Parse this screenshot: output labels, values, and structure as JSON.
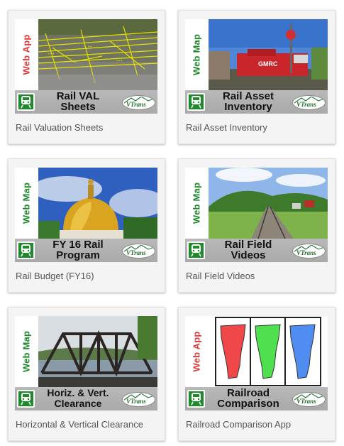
{
  "cards": [
    {
      "badge": "Web App",
      "badge_type": "app",
      "title_lines": [
        "Rail VAL",
        "Sheets"
      ],
      "caption": "Rail Valuation Sheets",
      "image": "aerial-railyard-photo"
    },
    {
      "badge": "Web Map",
      "badge_type": "map",
      "title_lines": [
        "Rail Asset",
        "Inventory"
      ],
      "caption": "Rail Asset Inventory",
      "image": "locomotive-photo"
    },
    {
      "badge": "Web Map",
      "badge_type": "map",
      "title_lines": [
        "FY 16 Rail",
        "Program"
      ],
      "caption": "Rail Budget (FY16)",
      "image": "capitol-dome-photo"
    },
    {
      "badge": "Web Map",
      "badge_type": "map",
      "title_lines": [
        "Rail Field",
        "Videos"
      ],
      "caption": "Rail Field Videos",
      "image": "railroad-track-photo"
    },
    {
      "badge": "Web Map",
      "badge_type": "map",
      "title_lines": [
        "Horiz. & Vert.",
        "Clearance"
      ],
      "caption": "Horizontal & Vertical Clearance",
      "image": "truss-bridge-photo"
    },
    {
      "badge": "Web App",
      "badge_type": "app",
      "title_lines": [
        "Railroad",
        "Comparison"
      ],
      "caption": "Railroad Comparison App",
      "image": "vermont-maps-comparison"
    }
  ],
  "logo_text": "VTrans",
  "colors": {
    "app_badge": "#e23a3a",
    "map_badge": "#1f8a2c",
    "train_icon_bg": "#1f8a2c",
    "card_bg": "#f4f4f4"
  }
}
